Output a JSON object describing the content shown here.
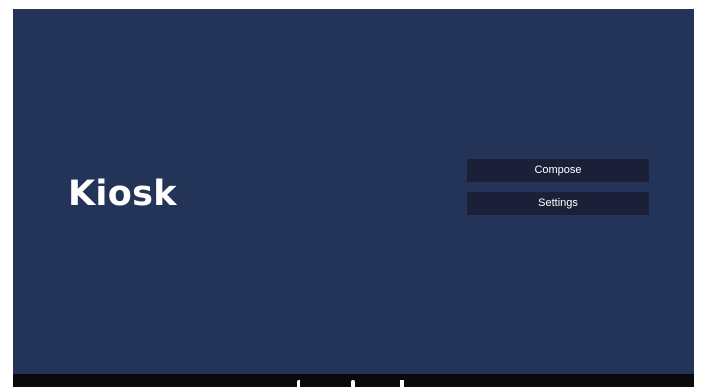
{
  "app": {
    "title": "Kiosk"
  },
  "menu": {
    "compose_label": "Compose",
    "settings_label": "Settings"
  },
  "colors": {
    "background": "#233458",
    "button": "#1b2038",
    "text": "#ffffff",
    "navbar": "#0a0a0a"
  },
  "navbar": {
    "icons": [
      "back-icon",
      "home-icon",
      "recents-icon"
    ]
  }
}
